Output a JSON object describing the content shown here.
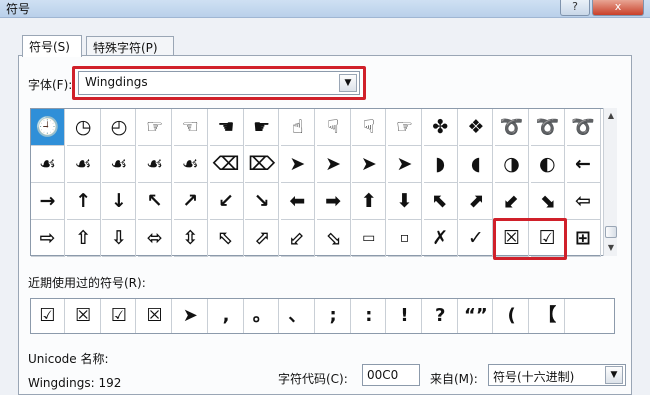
{
  "dialog": {
    "title": "符号",
    "close_label": "x",
    "help_label": "?"
  },
  "tabs": [
    {
      "label": "符号(S)"
    },
    {
      "label": "特殊字符(P)"
    }
  ],
  "font": {
    "label": "字体(F):",
    "value": "Wingdings"
  },
  "symbol_rows": [
    [
      "🕘",
      "◷",
      "◴",
      "☞",
      "☜",
      "☚",
      "☛",
      "☝",
      "☟",
      "☟",
      "☞",
      "✤",
      "❖",
      "➰",
      "➰",
      "➰"
    ],
    [
      "☙",
      "☙",
      "☙",
      "☙",
      "☙",
      "⌫",
      "⌦",
      "➤",
      "➤",
      "➤",
      "➤",
      "◗",
      "◖",
      "◑",
      "◐",
      "←"
    ],
    [
      "→",
      "↑",
      "↓",
      "↖",
      "↗",
      "↙",
      "↘",
      "⬅",
      "➡",
      "⬆",
      "⬇",
      "⬉",
      "⬈",
      "⬋",
      "⬊",
      "⇦"
    ],
    [
      "⇨",
      "⇧",
      "⇩",
      "⬄",
      "⇳",
      "⬁",
      "⬀",
      "⬃",
      "⬂",
      "▭",
      "▫",
      "✗",
      "✓",
      "☒",
      "☑",
      "⊞"
    ]
  ],
  "selected_index": 0,
  "recent": {
    "label": "近期使用过的符号(R):",
    "items": [
      "☑",
      "☒",
      "☑",
      "☒",
      "➤",
      ",",
      "。",
      "、",
      ";",
      ":",
      "!",
      "?",
      "“”",
      "(",
      "【"
    ]
  },
  "unicode": {
    "label": "Unicode 名称:",
    "value": "Wingdings: 192"
  },
  "char_code": {
    "label": "字符代码(C):",
    "value": "00C0"
  },
  "from": {
    "label": "来自(M):",
    "value": "符号(十六进制)"
  }
}
